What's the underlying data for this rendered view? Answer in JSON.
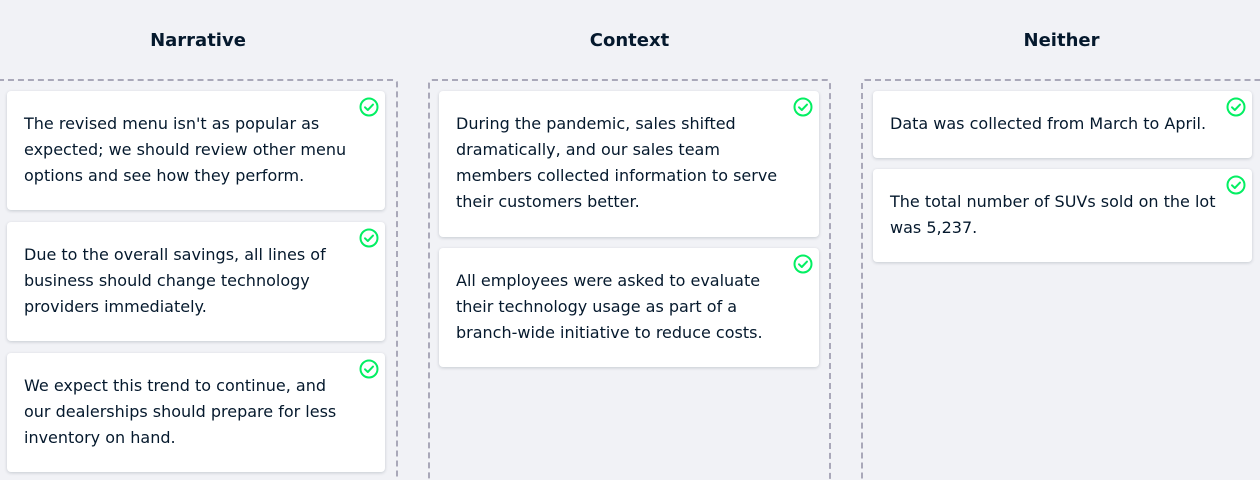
{
  "columns": [
    {
      "title": "Narrative",
      "cards": [
        {
          "text": "The revised menu isn't as popular as expected; we should review other menu options and see how they perform.",
          "icon": "check-circle-icon"
        },
        {
          "text": "Due to the overall savings, all lines of business should change technology providers immediately.",
          "icon": "check-circle-icon"
        },
        {
          "text": "We expect this trend to continue, and our dealerships should prepare for less inventory on hand.",
          "icon": "check-circle-icon"
        }
      ]
    },
    {
      "title": "Context",
      "cards": [
        {
          "text": "During the pandemic, sales shifted dramatically, and our sales team members collected information to serve their customers better.",
          "icon": "check-circle-icon"
        },
        {
          "text": "All employees were asked to evaluate their technology usage as part of a branch-wide initiative to reduce costs.",
          "icon": "check-circle-icon"
        }
      ]
    },
    {
      "title": "Neither",
      "cards": [
        {
          "text": "Data was collected from March to April.",
          "icon": "check-circle-icon"
        },
        {
          "text": "The total number of SUVs sold on the lot was 5,237.",
          "icon": "check-circle-icon"
        }
      ]
    }
  ],
  "colors": {
    "background": "#f1f2f6",
    "card": "#ffffff",
    "text": "#05192d",
    "correct": "#03ef62",
    "dashed_border": "#a9a8b9"
  }
}
